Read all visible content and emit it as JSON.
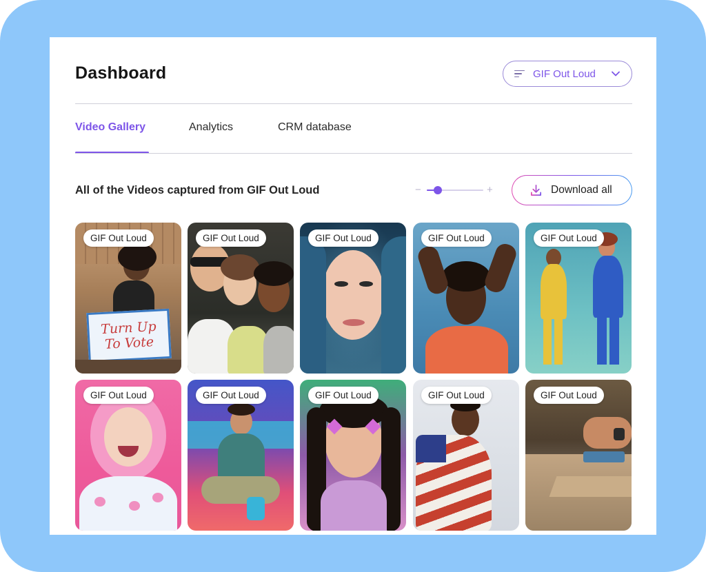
{
  "header": {
    "title": "Dashboard",
    "account_select": {
      "value": "GIF Out Loud",
      "icon": "filter-lines-icon",
      "chevron": "chevron-down-icon"
    }
  },
  "tabs": [
    {
      "label": "Video Gallery",
      "active": true
    },
    {
      "label": "Analytics",
      "active": false
    },
    {
      "label": "CRM database",
      "active": false
    }
  ],
  "gallery": {
    "title": "All of the Videos captured from GIF Out Loud",
    "zoom": {
      "minus": "−",
      "plus": "+",
      "level": 0.2
    },
    "download_label": "Download all",
    "tiles": [
      {
        "badge": "GIF Out Loud",
        "sticker": "Turn Up To Vote"
      },
      {
        "badge": "GIF Out Loud"
      },
      {
        "badge": "GIF Out Loud"
      },
      {
        "badge": "GIF Out Loud"
      },
      {
        "badge": "GIF Out Loud"
      },
      {
        "badge": "GIF Out Loud"
      },
      {
        "badge": "GIF Out Loud"
      },
      {
        "badge": "GIF Out Loud"
      },
      {
        "badge": "GIF Out Loud"
      },
      {
        "badge": "GIF Out Loud"
      }
    ]
  },
  "colors": {
    "frame": "#8ec7fa",
    "accent": "#7d55e8",
    "text": "#161616"
  }
}
